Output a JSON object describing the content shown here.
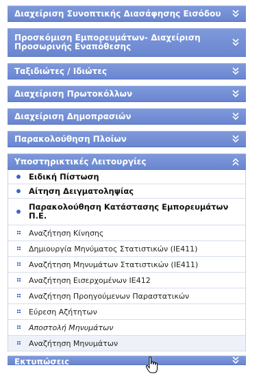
{
  "menu": {
    "sections": [
      {
        "label": "Διαχείριση Συνοπτικής Διασάφησης Εισόδου",
        "expanded": false,
        "icon": "chevron-down-icon"
      },
      {
        "label": "Προσκόμιση Εμπορευμάτων- Διαχείριση Προσωρινής Εναπόθεσης",
        "expanded": false,
        "icon": "chevron-down-icon"
      },
      {
        "label": "Ταξιδιώτες / Ιδιώτες",
        "expanded": false,
        "icon": "chevron-down-icon"
      },
      {
        "label": "Διαχείριση Πρωτοκόλλων",
        "expanded": false,
        "icon": "chevron-down-icon"
      },
      {
        "label": "Διαχείριση Δημοπρασιών",
        "expanded": false,
        "icon": "chevron-down-icon"
      },
      {
        "label": "Παρακολούθηση Πλοίων",
        "expanded": false,
        "icon": "chevron-down-icon"
      },
      {
        "label": "Υποστηρικτικές Λειτουργίες",
        "expanded": true,
        "icon": "chevron-up-icon"
      },
      {
        "label": "Εκτυπώσεις",
        "expanded": false,
        "icon": "chevron-down-icon"
      }
    ],
    "support_items": [
      {
        "label": "Ειδική Πίστωση",
        "style": "bold"
      },
      {
        "label": "Αίτηση Δειγματοληψίας",
        "style": "bold"
      },
      {
        "label": "Παρακολούθηση Κατάστασης Εμπορευμάτων Π.Ε.",
        "style": "bold"
      },
      {
        "label": "Αναζήτηση Κίνησης",
        "style": "normal"
      },
      {
        "label": "Δημιουργία Μηνύματος Στατιστικών (ΙΕ411)",
        "style": "normal"
      },
      {
        "label": "Αναζήτηση Μηνυμάτων Στατιστικών (ΙΕ411)",
        "style": "normal"
      },
      {
        "label": "Αναζήτηση Εισερχομένων ΙΕ412",
        "style": "normal"
      },
      {
        "label": "Αναζήτηση Προηγούμενων Παραστατικών",
        "style": "normal"
      },
      {
        "label": "Εύρεση Αζήτητων",
        "style": "normal"
      },
      {
        "label": "Αποστολή Μηνυμάτων",
        "style": "italic"
      },
      {
        "label": "Αναζήτηση Μηνυμάτων",
        "style": "normal"
      }
    ]
  },
  "colors": {
    "header_bg": "#7590d6",
    "bullet": "#3d66c6"
  }
}
